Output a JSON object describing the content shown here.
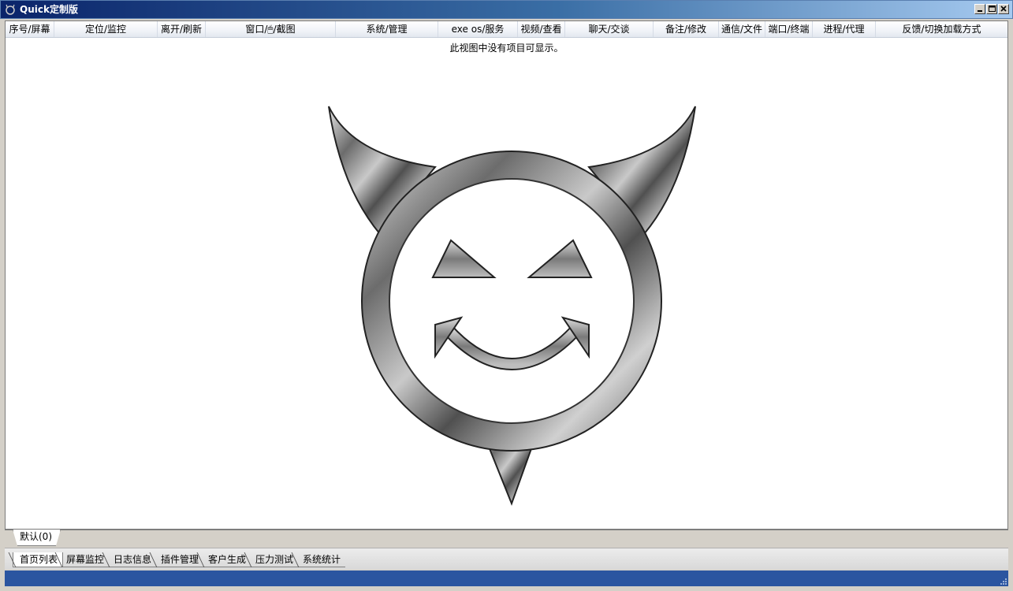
{
  "window": {
    "title": "Quick定制版",
    "icon": "devil-face-icon",
    "buttons": [
      "minimize-icon",
      "maximize-icon",
      "close-icon"
    ]
  },
  "list": {
    "columns": [
      "序号/屏幕",
      "定位/监控",
      "离开/刷新",
      "窗口/🖱/截图",
      "系统/管理",
      "exe os/服务",
      "视频/查看",
      "聊天/交谈",
      "备注/修改",
      "通信/文件",
      "端口/终端",
      "进程/代理",
      "反馈/切换加载方式"
    ],
    "empty_message": "此视图中没有项目可显示。"
  },
  "groups": {
    "active": "默认(0)"
  },
  "bottom_tabs": [
    "首页列表",
    "屏幕监控",
    "日志信息",
    "插件管理",
    "客户生成",
    "压力测试",
    "系统统计"
  ],
  "colors": {
    "statusbar": "#2b55a0",
    "titlebar_start": "#0a246a",
    "titlebar_end": "#a6caf0"
  }
}
